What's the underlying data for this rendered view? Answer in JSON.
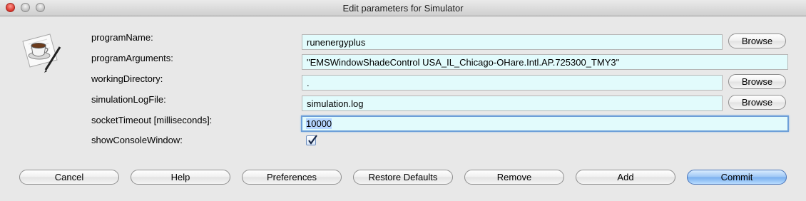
{
  "window": {
    "title": "Edit parameters for Simulator"
  },
  "icon": "coffee-cup-document-icon",
  "params": [
    {
      "label": "programName:",
      "value": "runenergyplus",
      "browse": "Browse"
    },
    {
      "label": "programArguments:",
      "value": "\"EMSWindowShadeControl USA_IL_Chicago-OHare.Intl.AP.725300_TMY3\""
    },
    {
      "label": "workingDirectory:",
      "value": ".",
      "browse": "Browse"
    },
    {
      "label": "simulationLogFile:",
      "value": "simulation.log",
      "browse": "Browse"
    },
    {
      "label": "socketTimeout [milliseconds]:",
      "value": "10000"
    },
    {
      "label": "showConsoleWindow:",
      "checked": true
    }
  ],
  "buttons": {
    "cancel": "Cancel",
    "help": "Help",
    "preferences": "Preferences",
    "restore_defaults": "Restore Defaults",
    "remove": "Remove",
    "add": "Add",
    "commit": "Commit"
  }
}
